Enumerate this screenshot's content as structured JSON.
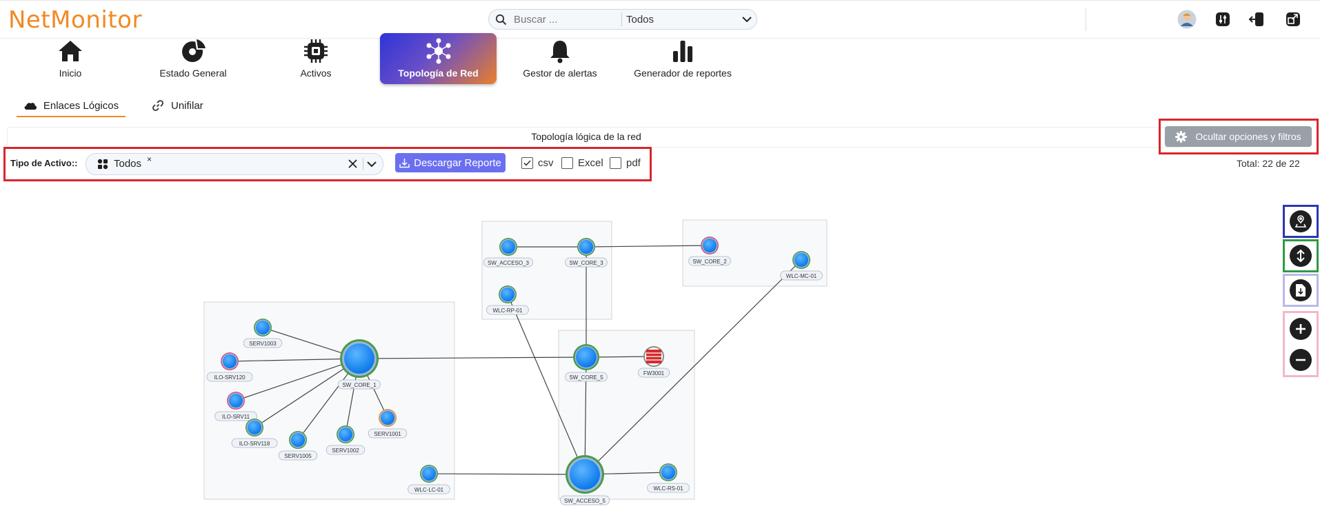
{
  "app": {
    "logo": "NetMonitor"
  },
  "search": {
    "placeholder": "Buscar ...",
    "scope": "Todos"
  },
  "nav": [
    {
      "label": "Inicio",
      "icon": "home-icon"
    },
    {
      "label": "Estado General",
      "icon": "gauge-icon"
    },
    {
      "label": "Activos",
      "icon": "chip-icon"
    },
    {
      "label": "Topología de Red",
      "icon": "topology-icon",
      "active": true
    },
    {
      "label": "Gestor de alertas",
      "icon": "bell-icon"
    },
    {
      "label": "Generador de reportes",
      "icon": "bar-chart-icon"
    }
  ],
  "subtabs": [
    {
      "label": "Enlaces Lógicos",
      "icon": "cloud-icon",
      "selected": true
    },
    {
      "label": "Unifilar",
      "icon": "link-icon"
    }
  ],
  "page_title": "Topología lógica de la red",
  "toggle_options_label": "Ocultar opciones y filtros",
  "filter": {
    "label": "Tipo de Activo::",
    "chip": "Todos",
    "chip_remove": "×",
    "download_label": "Descargar Reporte",
    "formats": [
      {
        "label": "csv",
        "checked": true
      },
      {
        "label": "Excel",
        "checked": false
      },
      {
        "label": "pdf",
        "checked": false
      }
    ]
  },
  "total_text": "Total: 22 de 22",
  "colors": {
    "accent": "#f08a24",
    "highlight_red": "#d9252a",
    "node_fill": "#1e90ff",
    "ring_green": "#4a9a4a",
    "ring_pink": "#d9527a",
    "ring_orange": "#f0903a",
    "button_purple": "#6a6ff0"
  },
  "topology": {
    "nodes": [
      {
        "id": "SW_ACCESO_3"
      },
      {
        "id": "SW_CORE_3"
      },
      {
        "id": "WLC-RP-01"
      },
      {
        "id": "SW_CORE_2"
      },
      {
        "id": "WLC-MC-01"
      },
      {
        "id": "SERV1003"
      },
      {
        "id": "ILO-SRV120"
      },
      {
        "id": "SW_CORE_1"
      },
      {
        "id": "ILO-SRV11"
      },
      {
        "id": "ILO-SRV118"
      },
      {
        "id": "SERV1005"
      },
      {
        "id": "SERV1002"
      },
      {
        "id": "SERV1001"
      },
      {
        "id": "WLC-LC-01"
      },
      {
        "id": "SW_CORE_5"
      },
      {
        "id": "FW3001"
      },
      {
        "id": "SW_ACCESO_5"
      },
      {
        "id": "WLC-RS-01"
      }
    ]
  },
  "side_tools": [
    {
      "icon": "location-icon"
    },
    {
      "icon": "vertical-arrows-icon"
    },
    {
      "icon": "document-download-icon"
    },
    {
      "icon": "plus-icon"
    },
    {
      "icon": "minus-icon"
    }
  ]
}
